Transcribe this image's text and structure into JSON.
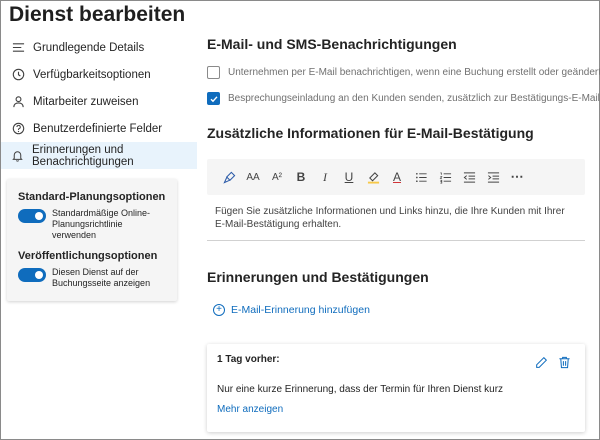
{
  "page": {
    "title": "Dienst bearbeiten"
  },
  "sidebar": {
    "items": [
      {
        "label": "Grundlegende Details",
        "icon": "lines-icon"
      },
      {
        "label": "Verfügbarkeitsoptionen",
        "icon": "clock-icon"
      },
      {
        "label": "Mitarbeiter zuweisen",
        "icon": "person-icon"
      },
      {
        "label": "Benutzerdefinierte Felder",
        "icon": "question-icon"
      },
      {
        "label": "Erinnerungen und Benachrichtigungen",
        "icon": "bell-icon",
        "active": true
      }
    ]
  },
  "options": {
    "planning_heading": "Standard-Planungsoptionen",
    "planning_toggle_label": "Standardmäßige Online-Planungsrichtlinie verwenden",
    "planning_toggle_on": true,
    "publish_heading": "Veröffentlichungsoptionen",
    "publish_toggle_label": "Diesen Dienst auf der Buchungsseite anzeigen",
    "publish_toggle_on": true
  },
  "notifications": {
    "heading": "E-Mail- und SMS-Benachrichtigungen",
    "notify_business_label": "Unternehmen per E-Mail benachrichtigen, wenn eine Buchung erstellt oder geändert wird.",
    "notify_business_checked": false,
    "invite_customer_label": "Besprechungseinladung an den Kunden senden, zusätzlich zur Bestätigungs-E-Mail",
    "invite_customer_checked": true
  },
  "extra_info": {
    "heading": "Zusätzliche Informationen für E-Mail-Bestätigung",
    "placeholder": "Fügen Sie zusätzliche Informationen und Links hinzu, die Ihre Kunden mit Ihrer E-Mail-Bestätigung erhalten.",
    "toolbar": {
      "font_size_label": "AA",
      "superscript_label": "A²",
      "bold_label": "B",
      "italic_label": "I",
      "underline_label": "U",
      "font_color_label": "A",
      "more_label": "⋯"
    }
  },
  "reminders": {
    "heading": "Erinnerungen und Bestätigungen",
    "add_label": "E-Mail-Erinnerung hinzufügen",
    "card": {
      "title": "1 Tag vorher:",
      "body": "Nur eine kurze Erinnerung, dass der Termin für Ihren Dienst kurz",
      "more_label": "Mehr anzeigen"
    }
  },
  "colors": {
    "accent": "#0f6cbd",
    "active_nav": "#e8f3fc"
  }
}
